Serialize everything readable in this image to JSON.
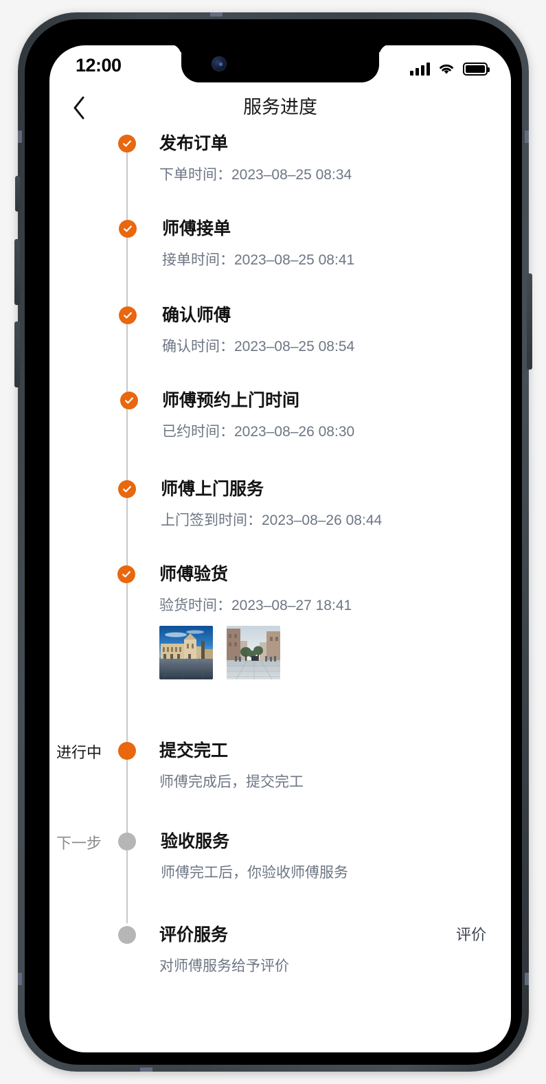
{
  "device": {
    "status_bar": {
      "time": "12:00",
      "signal_icon": "signal-bars-icon",
      "wifi_icon": "wifi-icon",
      "battery_icon": "battery-full-icon"
    }
  },
  "nav": {
    "back_icon": "chevron-left-icon",
    "title": "服务进度"
  },
  "colors": {
    "accent": "#e8670f",
    "pending_dot": "#b6b6b6",
    "timeline_line": "#c8c8c8",
    "title_text": "#131313",
    "desc_text": "#6d7684"
  },
  "timeline": {
    "steps": [
      {
        "id": "publish-order",
        "status": "done",
        "stage_label": "",
        "title": "发布订单",
        "desc": "下单时间：2023–08–25 08:34"
      },
      {
        "id": "master-accept",
        "status": "done",
        "stage_label": "",
        "title": "师傅接单",
        "desc": "接单时间：2023–08–25 08:41"
      },
      {
        "id": "confirm-master",
        "status": "done",
        "stage_label": "",
        "title": "确认师傅",
        "desc": "确认时间：2023–08–25 08:54"
      },
      {
        "id": "appointment-time",
        "status": "done",
        "stage_label": "",
        "title": "师傅预约上门时间",
        "desc": "已约时间：2023–08–26 08:30"
      },
      {
        "id": "onsite-service",
        "status": "done",
        "stage_label": "",
        "title": "师傅上门服务",
        "desc": "上门签到时间：2023–08–26 08:44"
      },
      {
        "id": "inspect-goods",
        "status": "done",
        "stage_label": "",
        "title": "师傅验货",
        "desc": "验货时间：2023–08–27 18:41",
        "photos": [
          "photo-plaza-buildings",
          "photo-pedestrian-street"
        ]
      },
      {
        "id": "submit-completion",
        "status": "current",
        "stage_label": "进行中",
        "title": "提交完工",
        "desc": "师傅完成后，提交完工"
      },
      {
        "id": "accept-service",
        "status": "pending",
        "stage_label": "下一步",
        "title": "验收服务",
        "desc": "师傅完工后，你验收师傅服务"
      },
      {
        "id": "rate-service",
        "status": "pending",
        "stage_label": "",
        "title": "评价服务",
        "desc": "对师傅服务给予评价",
        "action": "评价"
      }
    ]
  }
}
